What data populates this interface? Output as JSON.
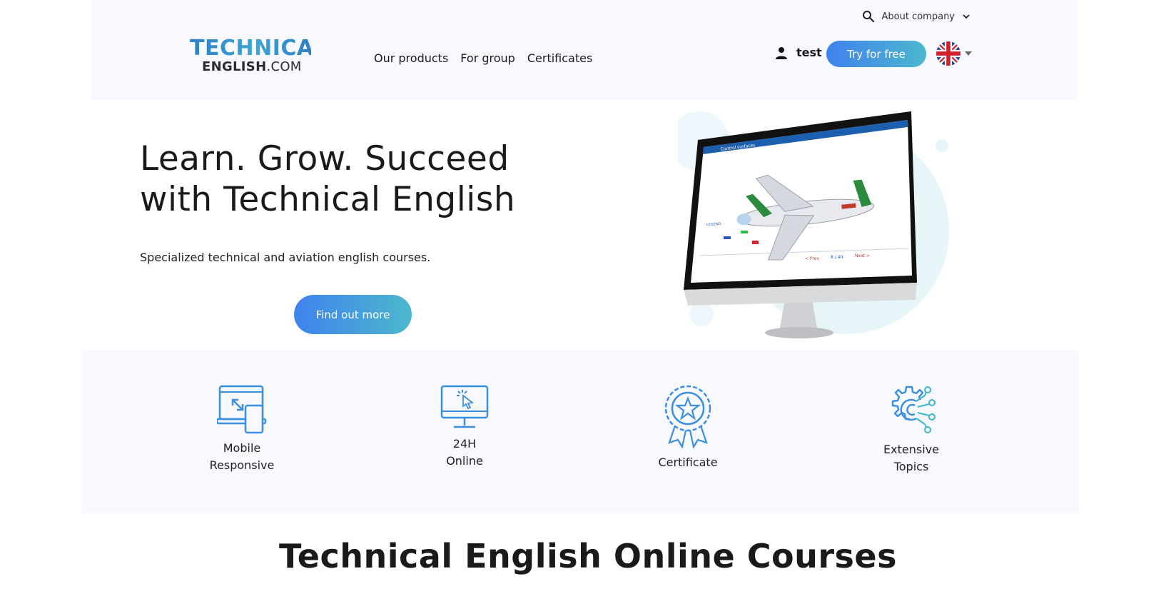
{
  "header": {
    "about_label": "About company",
    "logo": {
      "top": "TECHNICAL",
      "bottom_bold": "ENGLISH",
      "bottom_light": ".COM"
    },
    "nav": [
      {
        "label": "Our products"
      },
      {
        "label": "For group"
      },
      {
        "label": "Certificates"
      }
    ],
    "user_name": "test",
    "try_label": "Try for free"
  },
  "hero": {
    "title_line1": "Learn. Grow. Succeed",
    "title_line2": "with Technical English",
    "subtitle": "Specialized technical and aviation english courses.",
    "cta_label": "Find out more",
    "screen": {
      "title": "Control surfaces",
      "legend_title": "LEGEND",
      "pager": "8 / 40",
      "prev": "< Prev",
      "next": "Next >"
    }
  },
  "features": [
    {
      "icon": "mobile-responsive-icon",
      "line1": "Mobile",
      "line2": "Responsive"
    },
    {
      "icon": "monitor-click-icon",
      "line1": "24H",
      "line2": "Online"
    },
    {
      "icon": "certificate-badge-icon",
      "line1": "Certificate",
      "line2": ""
    },
    {
      "icon": "gear-network-icon",
      "line1": "Extensive",
      "line2": "Topics"
    }
  ],
  "section": {
    "title": "Technical English Online Courses"
  },
  "colors": {
    "accent_start": "#3f82ee",
    "accent_end": "#4db7ce",
    "icon_blue": "#3b8fe0",
    "panel_bg": "#f8f9fe"
  }
}
